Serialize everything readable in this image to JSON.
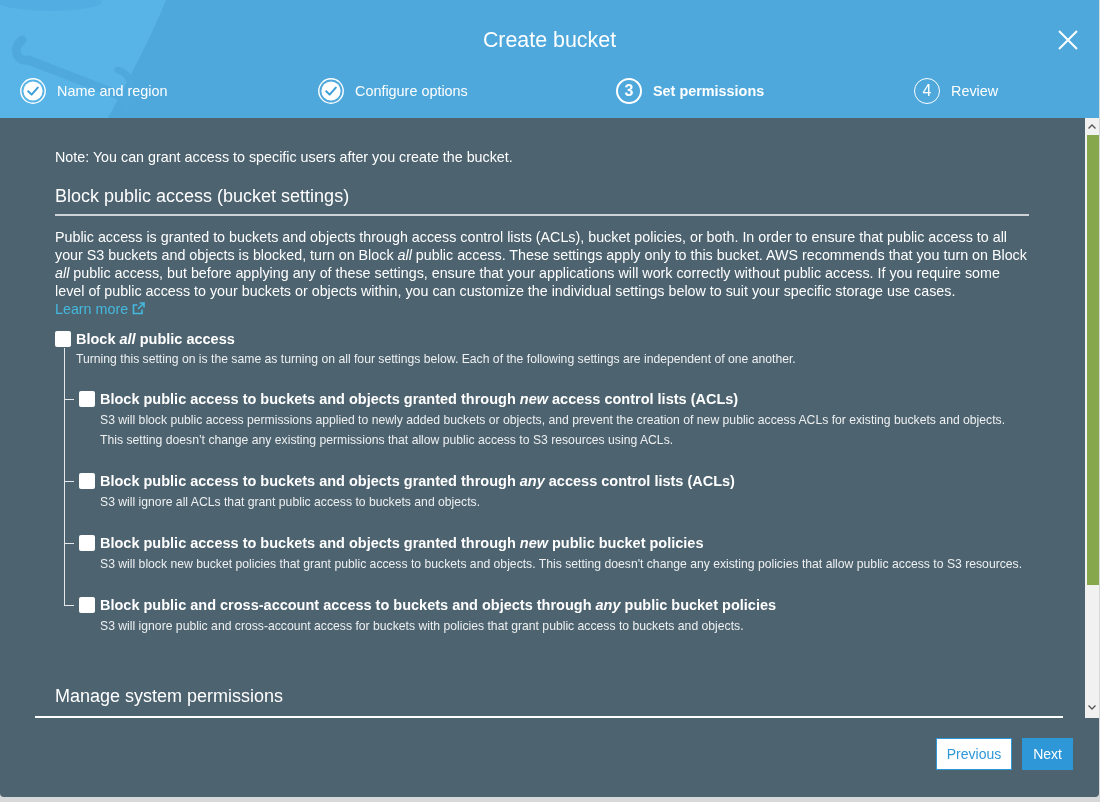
{
  "dialog": {
    "title": "Create bucket"
  },
  "steps": [
    {
      "label": "Name and region",
      "completed": true,
      "selected": false
    },
    {
      "label": "Configure options",
      "completed": true,
      "selected": false
    },
    {
      "number": "3",
      "label": "Set permissions",
      "completed": false,
      "selected": true
    },
    {
      "number": "4",
      "label": "Review",
      "completed": false,
      "selected": false
    }
  ],
  "note": "Note: You can grant access to specific users after you create the bucket.",
  "sections": [
    {
      "heading": "Block public access (bucket settings)",
      "description": "Public access is granted to buckets and objects through access control lists (ACLs), bucket policies, or both. In order to ensure that public access to all your S3 buckets and objects is blocked, turn on Block *all* public access. These settings apply only to this bucket. AWS recommends that you turn on Block *all* public access, but before applying any of these settings, ensure that your applications will work correctly without public access. If you require some level of public access to your buckets or objects within, you can customize the individual settings below to suit your specific storage use cases.",
      "link": "Learn more",
      "options": [
        {
          "label": "Block *all* public access",
          "description": "Turning this setting on is the same as turning on all four settings below. Each of the following settings are independent of one another.",
          "checked": false,
          "children": [
            {
              "label": "Block public access to buckets and objects granted through *new* access control lists (ACLs)",
              "description": "S3 will block public access permissions applied to newly added buckets or objects, and prevent the creation of new public access ACLs for existing buckets and objects. This setting doesn’t change any existing permissions that allow public access to S3 resources using ACLs.",
              "checked": false
            },
            {
              "label": "Block public access to buckets and objects granted through *any* access control lists (ACLs)",
              "description": "S3 will ignore all ACLs that grant public access to buckets and objects.",
              "checked": false
            },
            {
              "label": "Block public access to buckets and objects granted through *new* public bucket policies",
              "description": "S3 will block new bucket policies that grant public access to buckets and objects. This setting doesn't change any existing policies that allow public access to S3 resources.",
              "checked": false
            },
            {
              "label": "Block public and cross-account access to buckets and objects through *any* public bucket policies",
              "description": "S3 will ignore public and cross-account access for buckets with policies that grant public access to buckets and objects.",
              "checked": false
            }
          ]
        }
      ]
    },
    {
      "heading": "Manage system permissions"
    }
  ],
  "buttons": [
    {
      "label": "Previous",
      "kind": "secondary"
    },
    {
      "label": "Next",
      "kind": "primary"
    }
  ]
}
